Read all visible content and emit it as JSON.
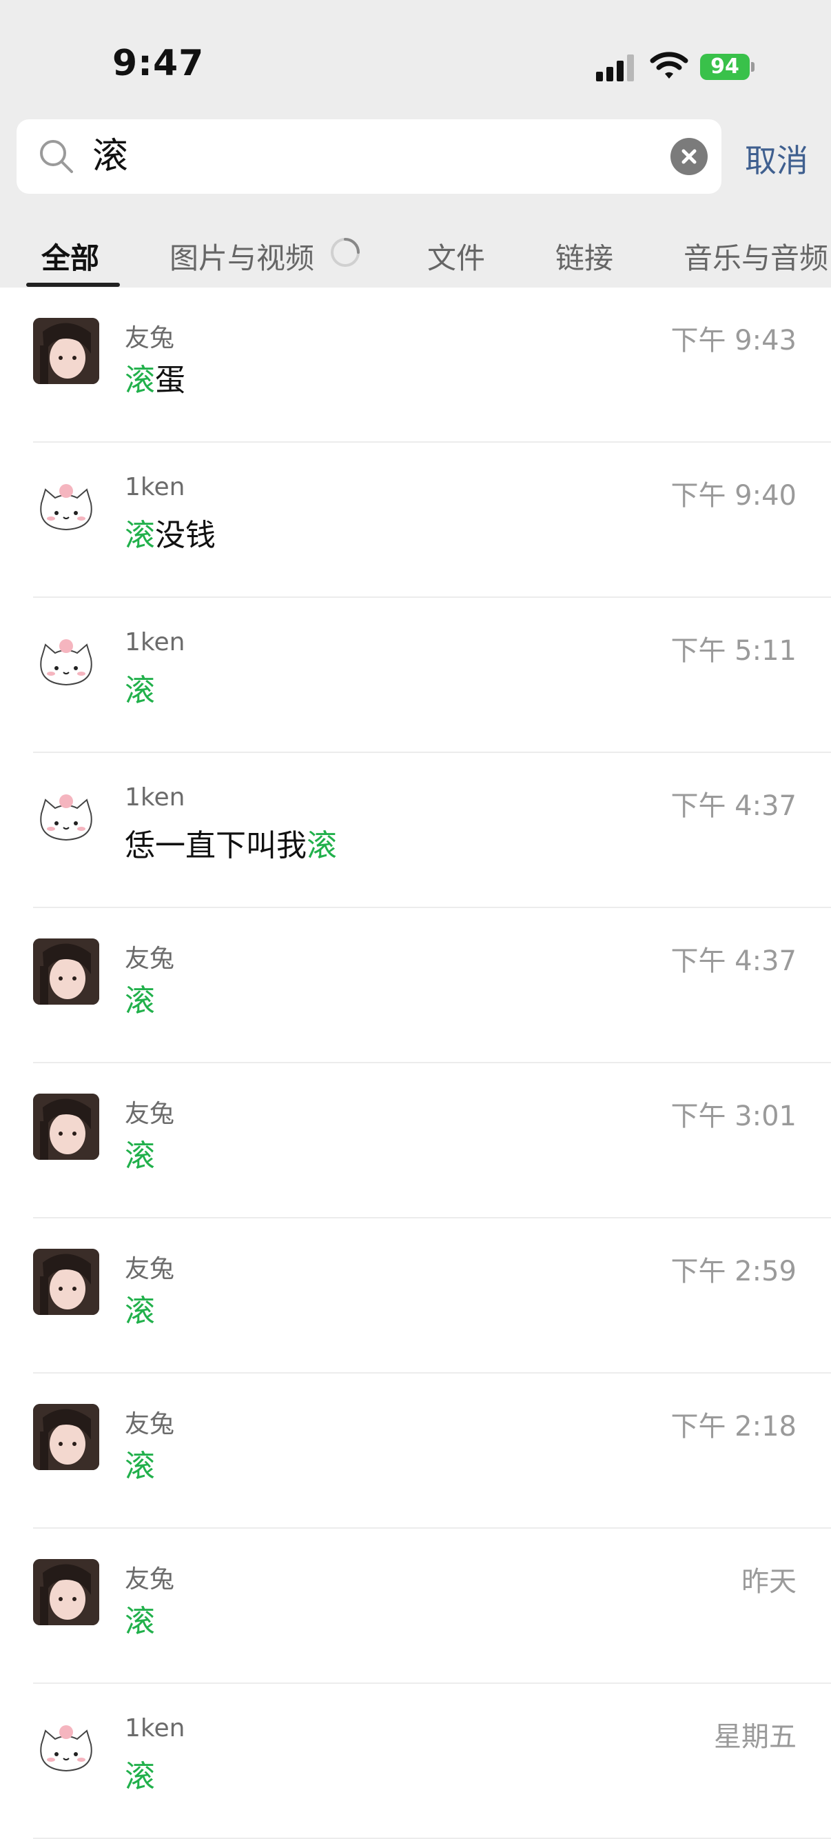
{
  "status_bar": {
    "time": "9:47",
    "battery": "94"
  },
  "search": {
    "query": "滚",
    "cancel_label": "取消"
  },
  "tabs": [
    {
      "label": "全部"
    },
    {
      "label": "图片与视频"
    },
    {
      "label": "文件"
    },
    {
      "label": "链接"
    },
    {
      "label": "音乐与音频"
    }
  ],
  "results": [
    {
      "sender": "友兔",
      "pre": "",
      "hl": "滚",
      "post": "蛋",
      "time": "下午 9:43",
      "avatar": "girl"
    },
    {
      "sender": "1ken",
      "pre": "",
      "hl": "滚",
      "post": "没钱",
      "time": "下午 9:40",
      "avatar": "cat"
    },
    {
      "sender": "1ken",
      "pre": "",
      "hl": "滚",
      "post": "",
      "time": "下午 5:11",
      "avatar": "cat"
    },
    {
      "sender": "1ken",
      "pre": "恁一直下叫我",
      "hl": "滚",
      "post": "",
      "time": "下午 4:37",
      "avatar": "cat"
    },
    {
      "sender": "友兔",
      "pre": "",
      "hl": "滚",
      "post": "",
      "time": "下午 4:37",
      "avatar": "girl"
    },
    {
      "sender": "友兔",
      "pre": "",
      "hl": "滚",
      "post": "",
      "time": "下午 3:01",
      "avatar": "girl"
    },
    {
      "sender": "友兔",
      "pre": "",
      "hl": "滚",
      "post": "",
      "time": "下午 2:59",
      "avatar": "girl"
    },
    {
      "sender": "友兔",
      "pre": "",
      "hl": "滚",
      "post": "",
      "time": "下午 2:18",
      "avatar": "girl"
    },
    {
      "sender": "友兔",
      "pre": "",
      "hl": "滚",
      "post": "",
      "time": "昨天",
      "avatar": "girl"
    },
    {
      "sender": "1ken",
      "pre": "",
      "hl": "滚",
      "post": "",
      "time": "星期五",
      "avatar": "cat"
    }
  ],
  "colors": {
    "highlight": "#21b04b",
    "cancel": "#3f5f8f",
    "battery": "#39c14a"
  },
  "icons": {
    "search": "search-icon",
    "clear": "clear-icon",
    "loading": "spinner-icon"
  }
}
